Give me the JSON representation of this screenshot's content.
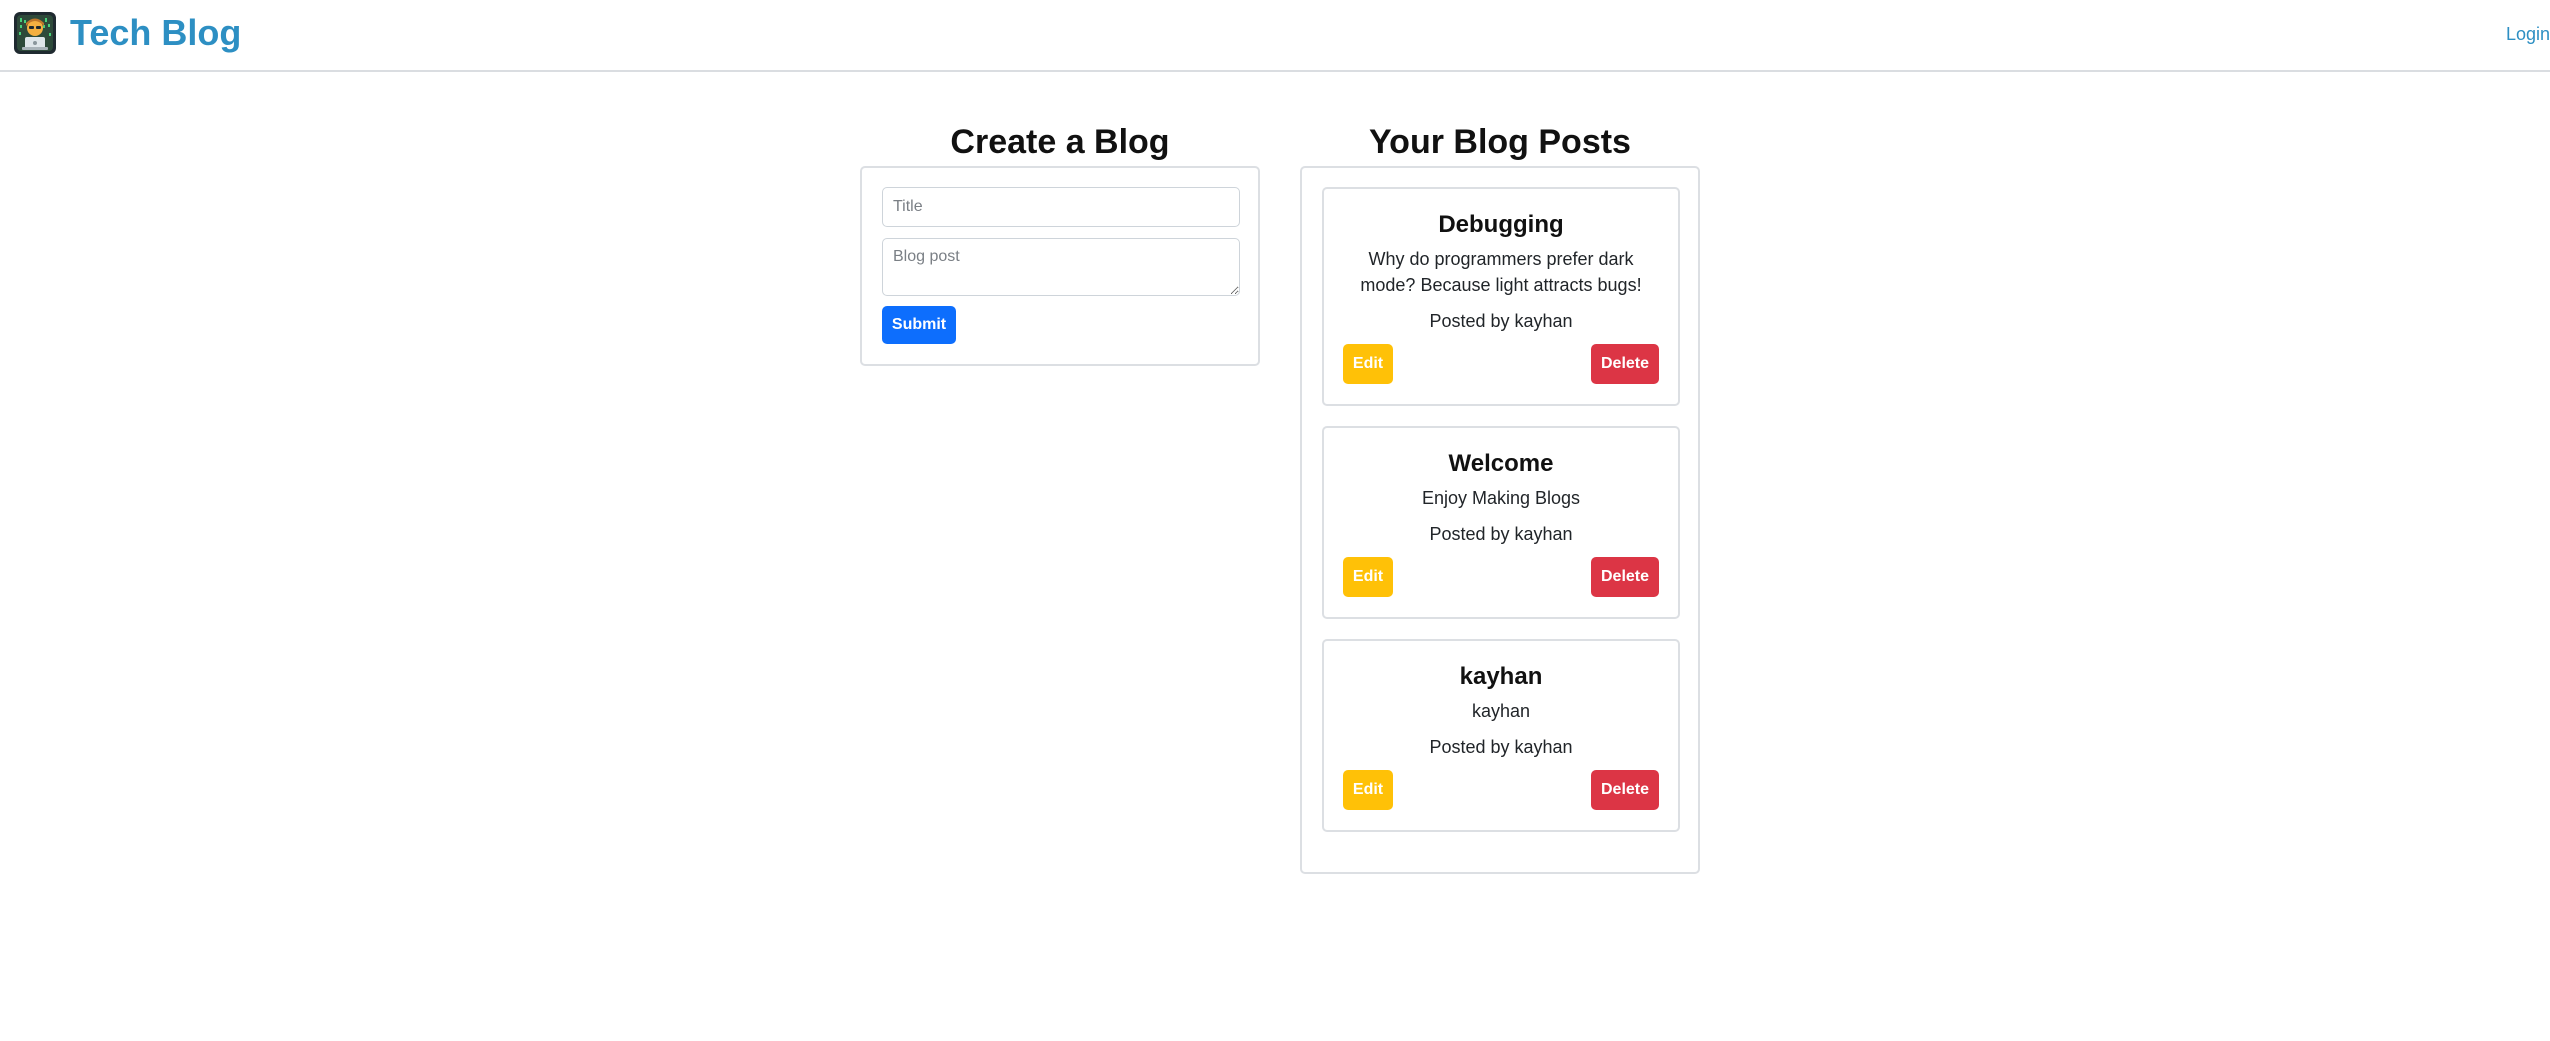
{
  "header": {
    "brand": "Tech Blog",
    "logo_icon": "hacker-avatar-icon",
    "login_label": "Login"
  },
  "create": {
    "heading": "Create a Blog",
    "title_placeholder": "Title",
    "title_value": "",
    "post_placeholder": "Blog post",
    "post_value": "",
    "submit_label": "Submit"
  },
  "posts": {
    "heading": "Your Blog Posts",
    "edit_label": "Edit",
    "delete_label": "Delete",
    "items": [
      {
        "title": "Debugging",
        "body": "Why do programmers prefer dark mode? Because light attracts bugs!",
        "author": "Posted by kayhan"
      },
      {
        "title": "Welcome",
        "body": "Enjoy Making Blogs",
        "author": "Posted by kayhan"
      },
      {
        "title": "kayhan",
        "body": "kayhan",
        "author": "Posted by kayhan"
      }
    ]
  },
  "colors": {
    "brand": "#2d8fc3",
    "submit": "#0d6efd",
    "edit": "#ffc107",
    "delete": "#dc3545"
  }
}
